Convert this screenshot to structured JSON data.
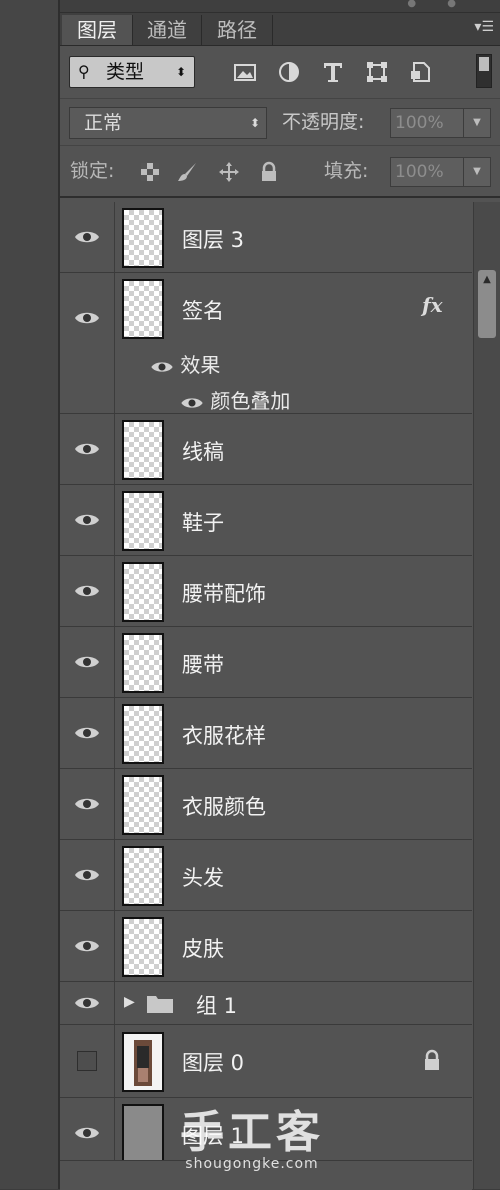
{
  "tabs": [
    {
      "label": "图层",
      "active": true
    },
    {
      "label": "通道",
      "active": false
    },
    {
      "label": "路径",
      "active": false
    }
  ],
  "filter": {
    "icon": "search-icon",
    "label": "类型",
    "icons": [
      "image-filter-icon",
      "adjustment-filter-icon",
      "type-filter-icon",
      "shape-filter-icon",
      "smart-object-filter-icon"
    ]
  },
  "blend": {
    "mode": "正常",
    "opacity_label": "不透明度:",
    "opacity_value": "100%"
  },
  "lock": {
    "label": "锁定:",
    "icons": [
      "lock-transparent-icon",
      "lock-image-icon",
      "lock-position-icon",
      "lock-all-icon"
    ],
    "fill_label": "填充:",
    "fill_value": "100%"
  },
  "layers": [
    {
      "name": "图层 3",
      "visible": true
    },
    {
      "name": "签名",
      "visible": true,
      "fx": "fx",
      "effects_label": "效果",
      "effect": "颜色叠加"
    },
    {
      "name": "线稿",
      "visible": true
    },
    {
      "name": "鞋子",
      "visible": true
    },
    {
      "name": "腰带配饰",
      "visible": true
    },
    {
      "name": "腰带",
      "visible": true
    },
    {
      "name": "衣服花样",
      "visible": true
    },
    {
      "name": "衣服颜色",
      "visible": true
    },
    {
      "name": "头发",
      "visible": true
    },
    {
      "name": "皮肤",
      "visible": true
    },
    {
      "name": "组 1",
      "visible": true,
      "type": "group"
    },
    {
      "name": "图层 0",
      "visible": false,
      "locked": true
    },
    {
      "name": "图层 1",
      "visible": true
    }
  ],
  "watermark": {
    "text": "手工客",
    "url": "shougongke.com"
  },
  "colors": {
    "panel_bg": "#535353",
    "tab_bar": "#3f3f3f",
    "text": "#f2f2f2"
  }
}
